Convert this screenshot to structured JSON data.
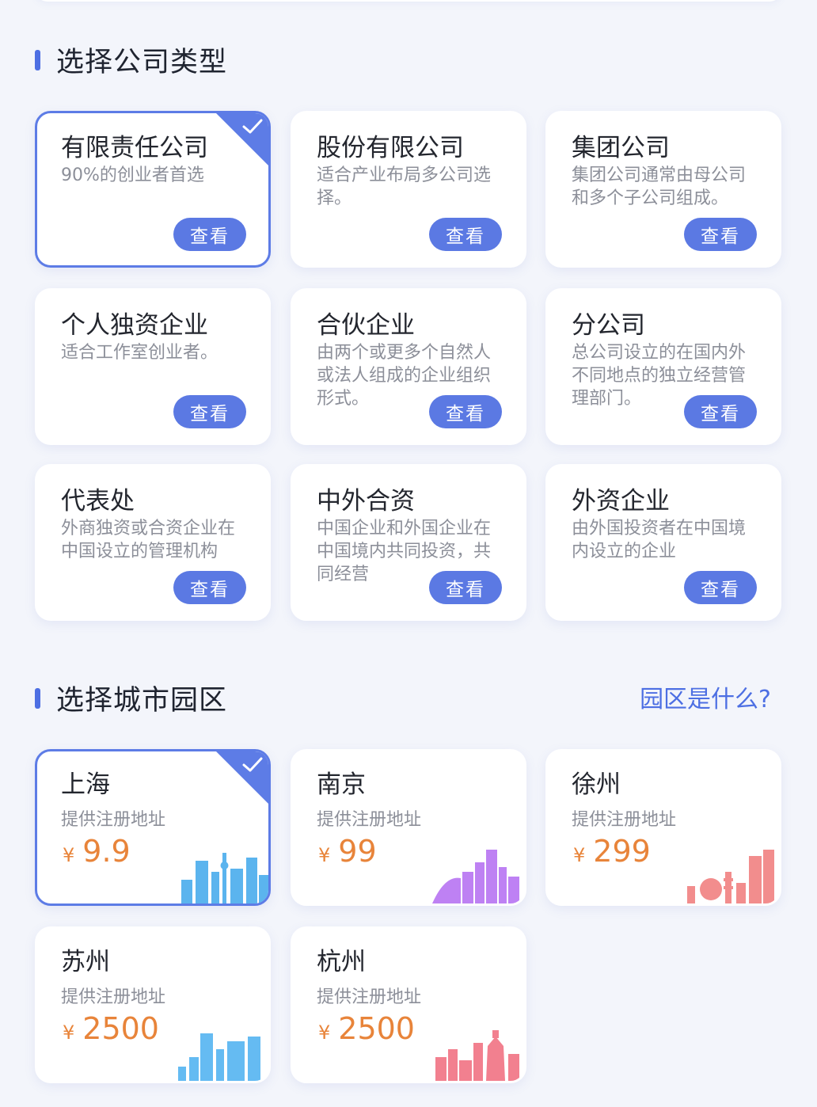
{
  "company_section": {
    "title": "选择公司类型",
    "view_label": "查看",
    "items": [
      {
        "title": "有限责任公司",
        "desc": "90%的创业者首选",
        "selected": true
      },
      {
        "title": "股份有限公司",
        "desc": "适合产业布局多公司选择。",
        "selected": false
      },
      {
        "title": "集团公司",
        "desc": "集团公司通常由母公司和多个子公司组成。",
        "selected": false
      },
      {
        "title": "个人独资企业",
        "desc": "适合工作室创业者。",
        "selected": false
      },
      {
        "title": "合伙企业",
        "desc": "由两个或更多个自然人或法人组成的企业组织形式。",
        "selected": false
      },
      {
        "title": "分公司",
        "desc": "总公司设立的在国内外不同地点的独立经营管理部门。",
        "selected": false
      },
      {
        "title": "代表处",
        "desc": "外商独资或合资企业在中国设立的管理机构",
        "selected": false
      },
      {
        "title": "中外合资",
        "desc": "中国企业和外国企业在中国境内共同投资，共同经营",
        "selected": false
      },
      {
        "title": "外资企业",
        "desc": "由外国投资者在中国境内设立的企业",
        "selected": false
      }
    ]
  },
  "city_section": {
    "title": "选择城市园区",
    "help_link": "园区是什么?",
    "currency": "¥",
    "items": [
      {
        "city": "上海",
        "desc": "提供注册地址",
        "price": "9.9",
        "selected": true,
        "skyline_color": "#3fa7ec"
      },
      {
        "city": "南京",
        "desc": "提供注册地址",
        "price": "99",
        "selected": false,
        "skyline_color": "#b36cf2"
      },
      {
        "city": "徐州",
        "desc": "提供注册地址",
        "price": "299",
        "selected": false,
        "skyline_color": "#f07a7a"
      },
      {
        "city": "苏州",
        "desc": "提供注册地址",
        "price": "2500",
        "selected": false,
        "skyline_color": "#4ab0f0"
      },
      {
        "city": "杭州",
        "desc": "提供注册地址",
        "price": "2500",
        "selected": false,
        "skyline_color": "#f06a7c"
      }
    ]
  },
  "icons": {
    "selected_check": "check-icon",
    "skyline": "city-skyline-icon"
  }
}
